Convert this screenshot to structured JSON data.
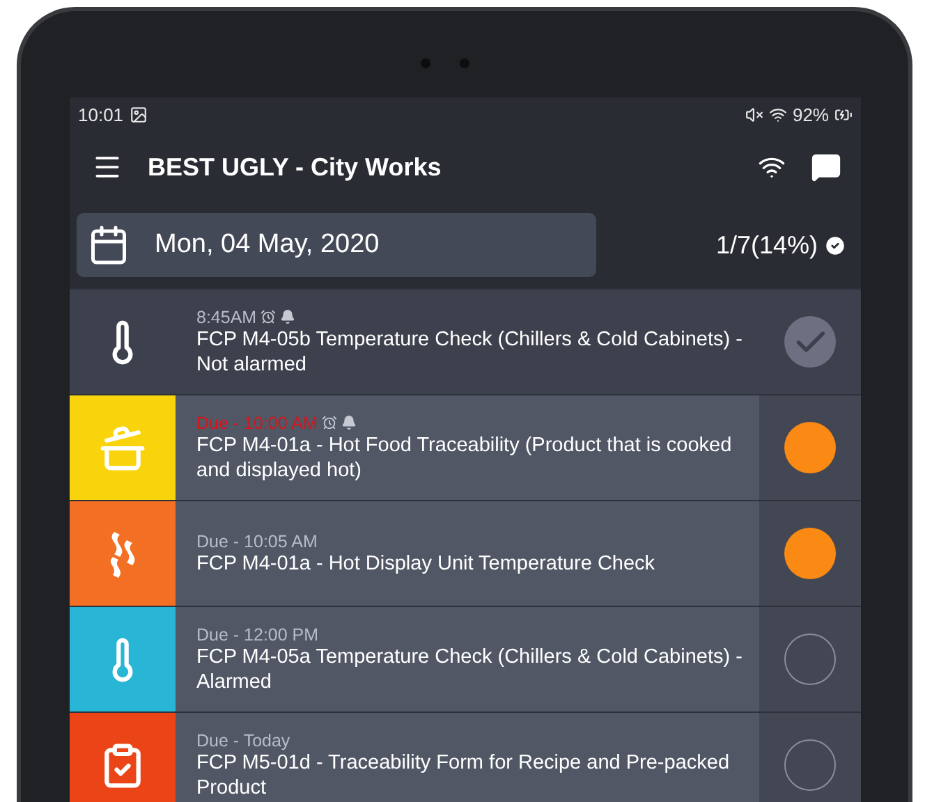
{
  "status_bar": {
    "time": "10:01",
    "battery": "92%"
  },
  "app_bar": {
    "title": "BEST UGLY - City Works"
  },
  "date_field": {
    "value": "Mon, 04 May, 2020"
  },
  "progress": {
    "text": "1/7(14%)"
  },
  "tasks": [
    {
      "kind": "thermometer",
      "time": "8:45AM",
      "overdue": false,
      "alarm": true,
      "title": "FCP M4-05b Temperature Check (Chillers & Cold Cabinets) - Not alarmed",
      "done": true
    },
    {
      "kind": "pan",
      "color": "#f9d40c",
      "time": "Due - 10:00 AM",
      "overdue": true,
      "alarm": true,
      "title": "FCP M4-01a - Hot Food Traceability (Product that is cooked and displayed hot)",
      "done": false,
      "in_progress": true
    },
    {
      "kind": "heat",
      "color": "#f26f23",
      "time": "Due - 10:05 AM",
      "overdue": false,
      "alarm": false,
      "title": "FCP M4-01a - Hot Display Unit Temperature Check",
      "done": false,
      "in_progress": true
    },
    {
      "kind": "thermometer",
      "color": "#29b5d6",
      "time": "Due - 12:00 PM",
      "overdue": false,
      "alarm": false,
      "title": "FCP M4-05a Temperature Check (Chillers & Cold Cabinets) - Alarmed",
      "done": false,
      "in_progress": false
    },
    {
      "kind": "clipboard",
      "color": "#ea4417",
      "time": "Due - Today",
      "overdue": false,
      "alarm": false,
      "title": "FCP M5-01d - Traceability Form for Recipe and Pre-packed Product",
      "done": false,
      "in_progress": false
    }
  ]
}
